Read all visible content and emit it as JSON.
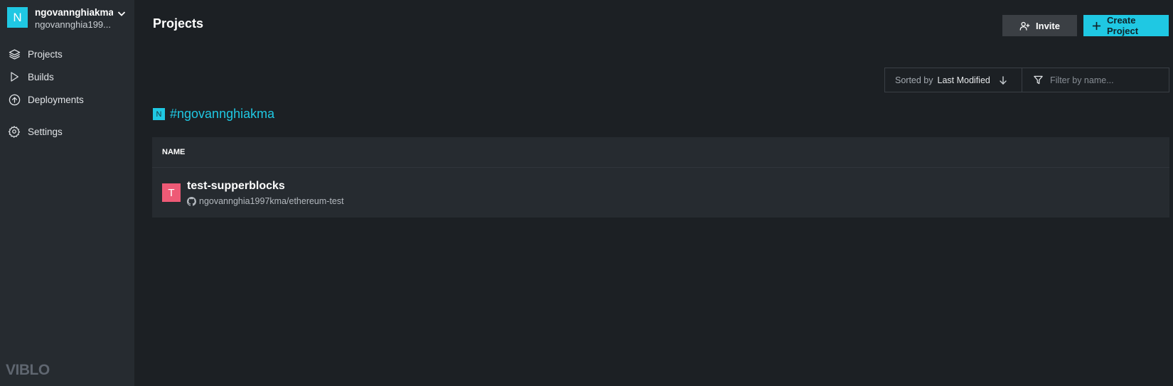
{
  "account": {
    "avatar_letter": "N",
    "name": "ngovannghiakma",
    "sub": "ngovannghia199..."
  },
  "nav": {
    "projects": "Projects",
    "builds": "Builds",
    "deployments": "Deployments",
    "settings": "Settings"
  },
  "logo": "VIBLO",
  "header": {
    "title": "Projects",
    "invite_label": "Invite",
    "create_label": "Create Project"
  },
  "toolbar": {
    "sort_label": "Sorted by",
    "sort_value": "Last Modified",
    "filter_placeholder": "Filter by name..."
  },
  "org": {
    "avatar_letter": "N",
    "name": "#ngovannghiakma"
  },
  "table": {
    "header_name": "NAME",
    "rows": [
      {
        "avatar_letter": "T",
        "name": "test-supperblocks",
        "repo": "ngovannghia1997kma/ethereum-test"
      }
    ]
  },
  "colors": {
    "accent": "#1fc8e3",
    "project_avatar": "#ee5a76",
    "sidebar_bg": "#262b30",
    "page_bg": "#1c2024"
  }
}
